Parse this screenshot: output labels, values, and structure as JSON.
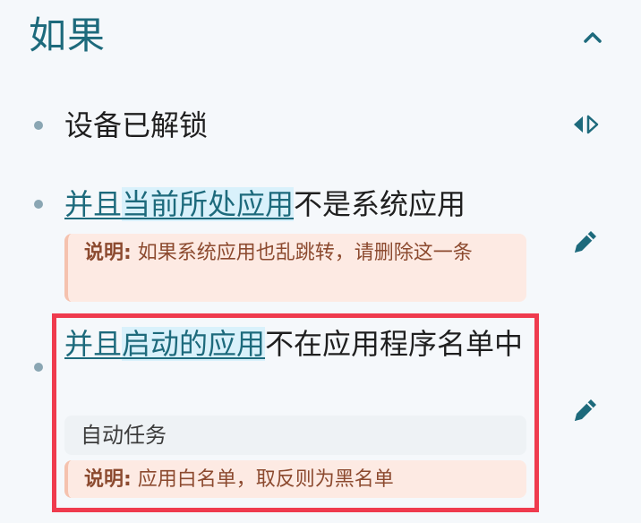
{
  "section": {
    "title": "如果"
  },
  "conditions": [
    {
      "text": "设备已解锁"
    },
    {
      "link_prefix": "并且",
      "link_highlight": "当前所处应用",
      "suffix": "不是系统应用",
      "note_label": "说明:",
      "note_text": " 如果系统应用也乱跳转，请删除这一条"
    },
    {
      "link_prefix": "并且",
      "link_highlight": "启动的应用",
      "suffix": "不在应用程序名单中",
      "tag": "自动任务",
      "note_label": "说明:",
      "note_text": " 应用白名单，取反则为黑名单"
    }
  ],
  "icons": {
    "collapse": "chevron-up-icon",
    "switch": "switch-arrows-icon",
    "edit": "pencil-icon"
  },
  "colors": {
    "accent": "#1d6a7c",
    "highlight": "#d9f1fb",
    "note_bg": "#fdeae3",
    "note_text": "#8c4a2f",
    "selection_frame": "#ef3b4e"
  }
}
